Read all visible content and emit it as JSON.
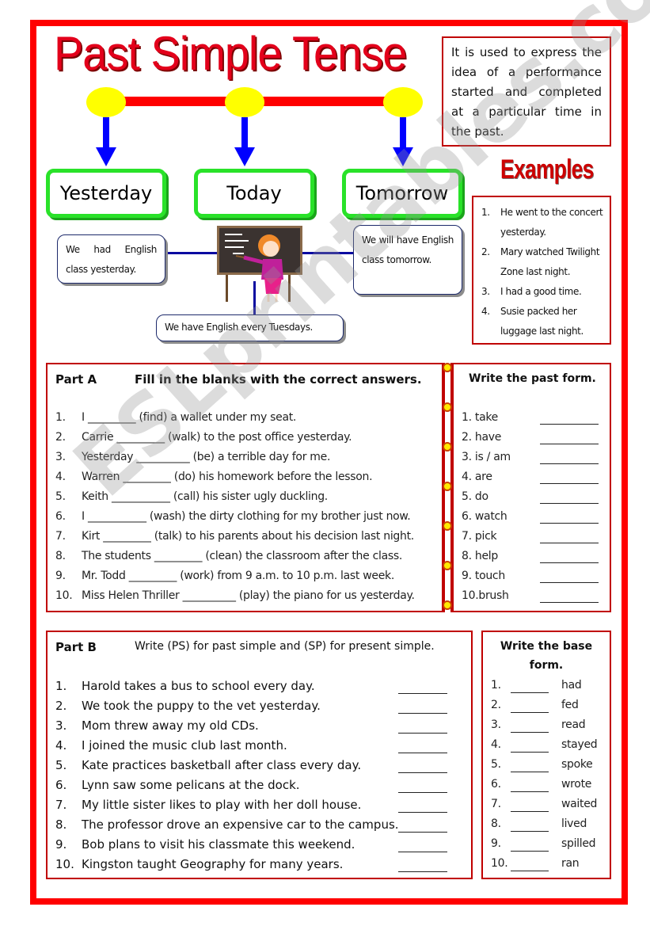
{
  "header": {
    "title": "Past Simple Tense",
    "definition": "It is used to express the idea of a performance started and completed at a particular time in the past."
  },
  "timeline": {
    "labels": [
      "Yesterday",
      "Today",
      "Tomorrow"
    ],
    "bubbles": {
      "yesterday": "We had English class yesterday.",
      "today": "We have English every Tuesdays.",
      "tomorrow": "We will have English class tomorrow."
    }
  },
  "examples": {
    "title": "Examples",
    "items": [
      {
        "num": "1.",
        "text": "He went to the concert yesterday."
      },
      {
        "num": "2.",
        "text": "Mary watched Twilight Zone last night."
      },
      {
        "num": "3.",
        "text": "I had a good time."
      },
      {
        "num": "4.",
        "text": "Susie packed her luggage last night."
      }
    ]
  },
  "part_a": {
    "label": "Part A",
    "instruction": "Fill in the blanks with the correct answers.",
    "items": [
      {
        "num": "1.",
        "before": "I",
        "blank": "_________",
        "after": "(find) a wallet under my seat."
      },
      {
        "num": "2.",
        "before": "Carrie",
        "blank": "_________",
        "after": "(walk) to the post office yesterday."
      },
      {
        "num": "3.",
        "before": "Yesterday",
        "blank": "__________",
        "after": "(be) a terrible day for me."
      },
      {
        "num": "4.",
        "before": "Warren",
        "blank": "_________",
        "after": "(do) his homework before the lesson."
      },
      {
        "num": "5.",
        "before": "Keith",
        "blank": "___________",
        "after": "(call) his sister ugly duckling."
      },
      {
        "num": "6.",
        "before": "I",
        "blank": "___________",
        "after": "(wash) the dirty clothing for my brother just now."
      },
      {
        "num": "7.",
        "before": "Kirt",
        "blank": "_________",
        "after": "(talk) to his parents about his decision last night."
      },
      {
        "num": "8.",
        "before": "The students",
        "blank": "_________",
        "after": "(clean) the classroom after the class."
      },
      {
        "num": "9.",
        "before": "Mr. Todd",
        "blank": "_________",
        "after": "(work) from 9 a.m. to 10 p.m. last week."
      },
      {
        "num": "10.",
        "before": "Miss Helen Thriller",
        "blank": "__________",
        "after": "(play) the piano for us yesterday."
      }
    ]
  },
  "past_form": {
    "title": "Write the past form.",
    "items": [
      "1. take",
      "2. have",
      "3. is / am",
      "4. are",
      "5. do",
      "6. watch",
      "7. pick",
      "8. help",
      "9. touch",
      "10.brush"
    ],
    "blank": "_________"
  },
  "part_b": {
    "label": "Part B",
    "instruction": "Write (PS) for past simple and (SP) for present simple.",
    "items": [
      {
        "num": "1.",
        "text": "Harold takes a bus to school every day."
      },
      {
        "num": "2.",
        "text": "We took the puppy to the vet yesterday."
      },
      {
        "num": "3.",
        "text": "Mom threw away my old CDs."
      },
      {
        "num": "4.",
        "text": "I joined the music club last month."
      },
      {
        "num": "5.",
        "text": "Kate practices basketball after class every day."
      },
      {
        "num": "6.",
        "text": "Lynn saw some pelicans at the dock."
      },
      {
        "num": "7.",
        "text": "My little sister likes to play with her doll house."
      },
      {
        "num": "8.",
        "text": "The professor drove an expensive car to the campus."
      },
      {
        "num": "9.",
        "text": "Bob plans to visit his classmate this weekend."
      },
      {
        "num": "10.",
        "text": "Kingston taught Geography for many years."
      }
    ]
  },
  "base_form": {
    "title_line1": "Write the base",
    "title_line2": "form.",
    "items": [
      {
        "num": "1.",
        "word": "had"
      },
      {
        "num": "2.",
        "word": "fed"
      },
      {
        "num": "3.",
        "word": "read"
      },
      {
        "num": "4.",
        "word": "stayed"
      },
      {
        "num": "5.",
        "word": "spoke"
      },
      {
        "num": "6.",
        "word": "wrote"
      },
      {
        "num": "7.",
        "word": "waited"
      },
      {
        "num": "8.",
        "word": "lived"
      },
      {
        "num": "9.",
        "word": "spilled"
      },
      {
        "num": "10.",
        "word": "ran"
      }
    ]
  },
  "watermark": "ESLprintables.com",
  "colors": {
    "frame": "#ff0000",
    "box_border": "#c00000",
    "title": "#e3001b",
    "timeline_dot": "#ffff00",
    "arrow": "#0000ff",
    "time_box_border": "#29e229"
  }
}
